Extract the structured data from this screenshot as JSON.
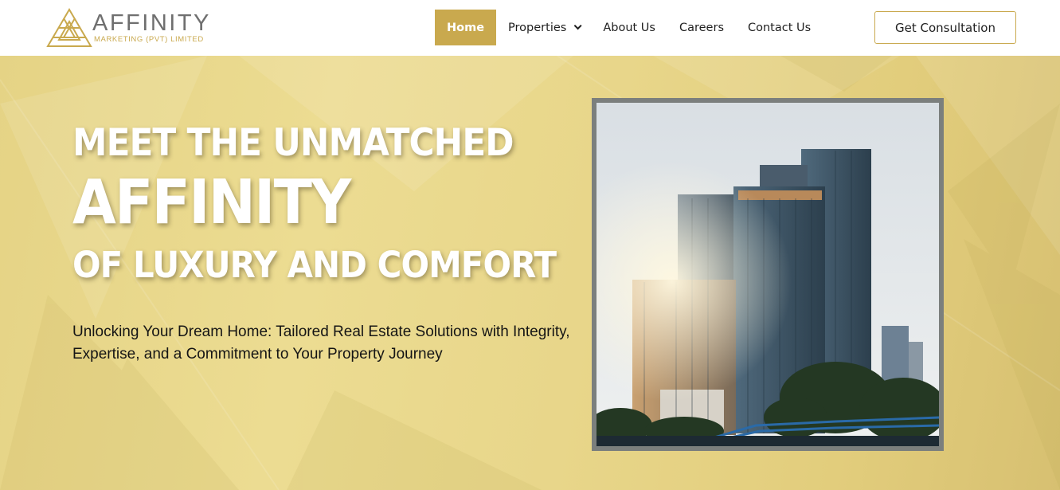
{
  "brand": {
    "name": "AFFINITY",
    "tagline": "MARKETING (PVT) LIMITED",
    "logo_icon": "triangle-lattice-logo",
    "accent_color": "#c9a94e"
  },
  "nav": {
    "items": [
      {
        "label": "Home",
        "active": true
      },
      {
        "label": "Properties",
        "has_dropdown": true,
        "icon": "chevron-down-icon"
      },
      {
        "label": "About Us"
      },
      {
        "label": "Careers"
      },
      {
        "label": "Contact Us"
      }
    ],
    "cta_label": "Get Consultation"
  },
  "hero": {
    "line1": "MEET THE UNMATCHED",
    "line2": "AFFINITY",
    "line3": "OF LUXURY AND COMFORT",
    "subtitle": "Unlocking Your Dream Home: Tailored Real Estate Solutions with Integrity, Expertise, and a Commitment to Your Property Journey",
    "background_color": "#e8d68a",
    "image": "city-skyscrapers-photo"
  }
}
